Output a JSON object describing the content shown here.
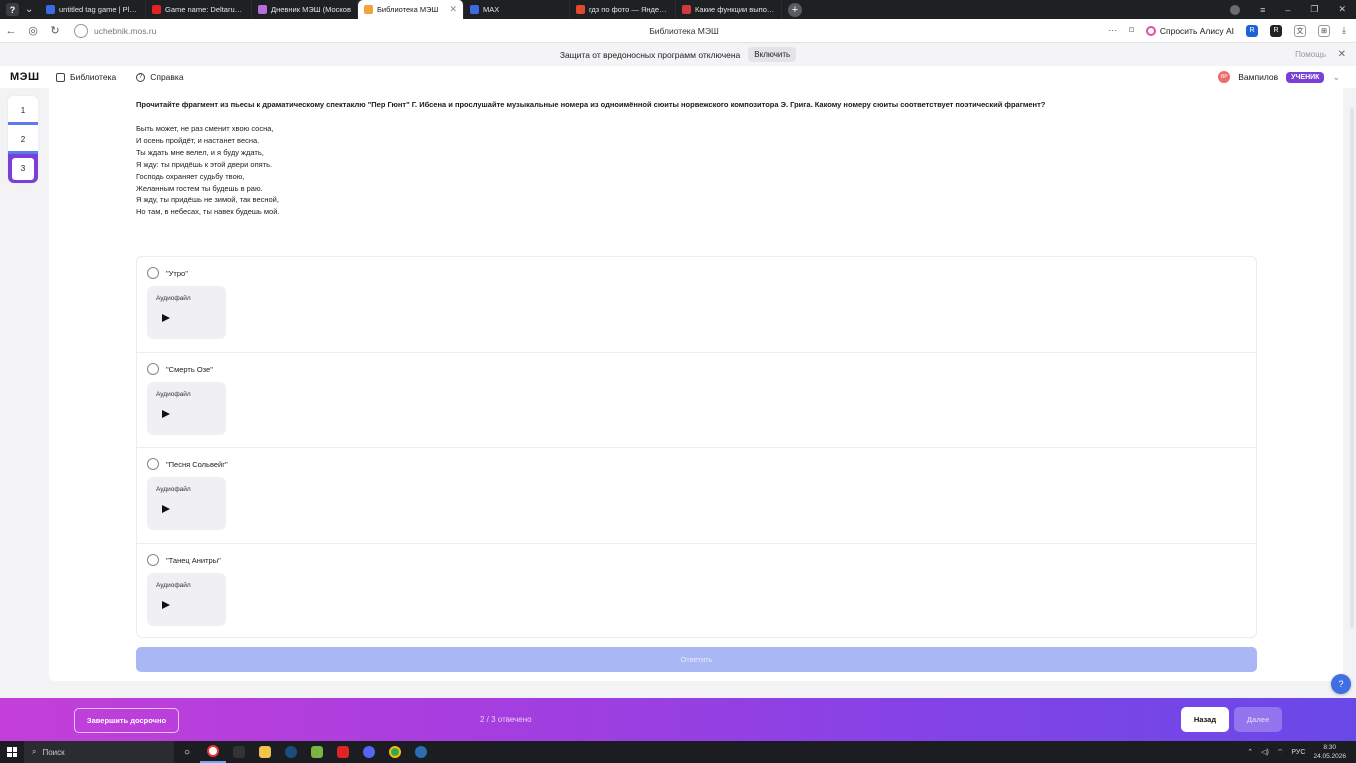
{
  "browser": {
    "tabs": [
      {
        "title": "untitled tag game | Play o",
        "color": "#3b6be0",
        "active": false
      },
      {
        "title": "Game name: Deltarune: C",
        "color": "#e02424",
        "active": false
      },
      {
        "title": "Дневник МЭШ (Москов",
        "color": "#b36ee0",
        "active": false
      },
      {
        "title": "Библиотека МЭШ",
        "color": "#f0a43a",
        "active": true
      },
      {
        "title": "MAX",
        "color": "#3b6be0",
        "active": false
      },
      {
        "title": "гдз по фото — Яндекс: на",
        "color": "#e04a2a",
        "active": false
      },
      {
        "title": "Какие функции выполня",
        "color": "#d03a3a",
        "active": false
      }
    ],
    "url": "uchebnik.mos.ru",
    "page_title": "Библиотека МЭШ",
    "alice_label": "Спросить Алису AI",
    "warning": {
      "text": "Защита от вредоносных программ отключена",
      "enable_label": "Включить",
      "help_label": "Помощь"
    }
  },
  "app": {
    "logo": "МЭШ",
    "nav": {
      "library": "Библиотека",
      "help": "Справка"
    },
    "user": {
      "initials": "ВР",
      "name": "Вампилов",
      "role": "УЧЕНИК"
    }
  },
  "steps": [
    "1",
    "2",
    "3"
  ],
  "task": {
    "question": "Прочитайте фрагмент из пьесы к драматическому спектаклю \"Пер Гюнт\" Г. Ибсена и прослушайте музыкальные номера из одноимённой сюиты норвежского композитора Э. Грига. Какому номеру сюиты соответствует поэтический фрагмент?",
    "poem": [
      "Быть может, не раз сменит хвою сосна,",
      "И осень пройдёт, и настанет весна.",
      "Ты ждать мне велел, и я буду ждать,",
      "Я жду: ты придёшь к этой двери опять.",
      "Господь охраняет судьбу твою,",
      "Желанным гостем ты будешь в раю.",
      "Я жду, ты придёшь не зимой, так весной,",
      "Но там, в небесах, ты навек будешь мой."
    ],
    "options": [
      {
        "label": "\"Утро\"",
        "audio_label": "Аудиофайл"
      },
      {
        "label": "\"Смерть Озе\"",
        "audio_label": "Аудиофайл"
      },
      {
        "label": "\"Песня Сольвейг\"",
        "audio_label": "Аудиофайл"
      },
      {
        "label": "\"Танец Анитры\"",
        "audio_label": "Аудиофайл"
      }
    ],
    "answer_label": "Ответить"
  },
  "footer": {
    "finish_label": "Завершить досрочно",
    "answered": "2 / 3 отвечено",
    "back_label": "Назад",
    "next_label": "Далее"
  },
  "taskbar": {
    "search_label": "Поиск",
    "lang": "РУС",
    "time": "8:30",
    "date": "24.05.2026"
  }
}
